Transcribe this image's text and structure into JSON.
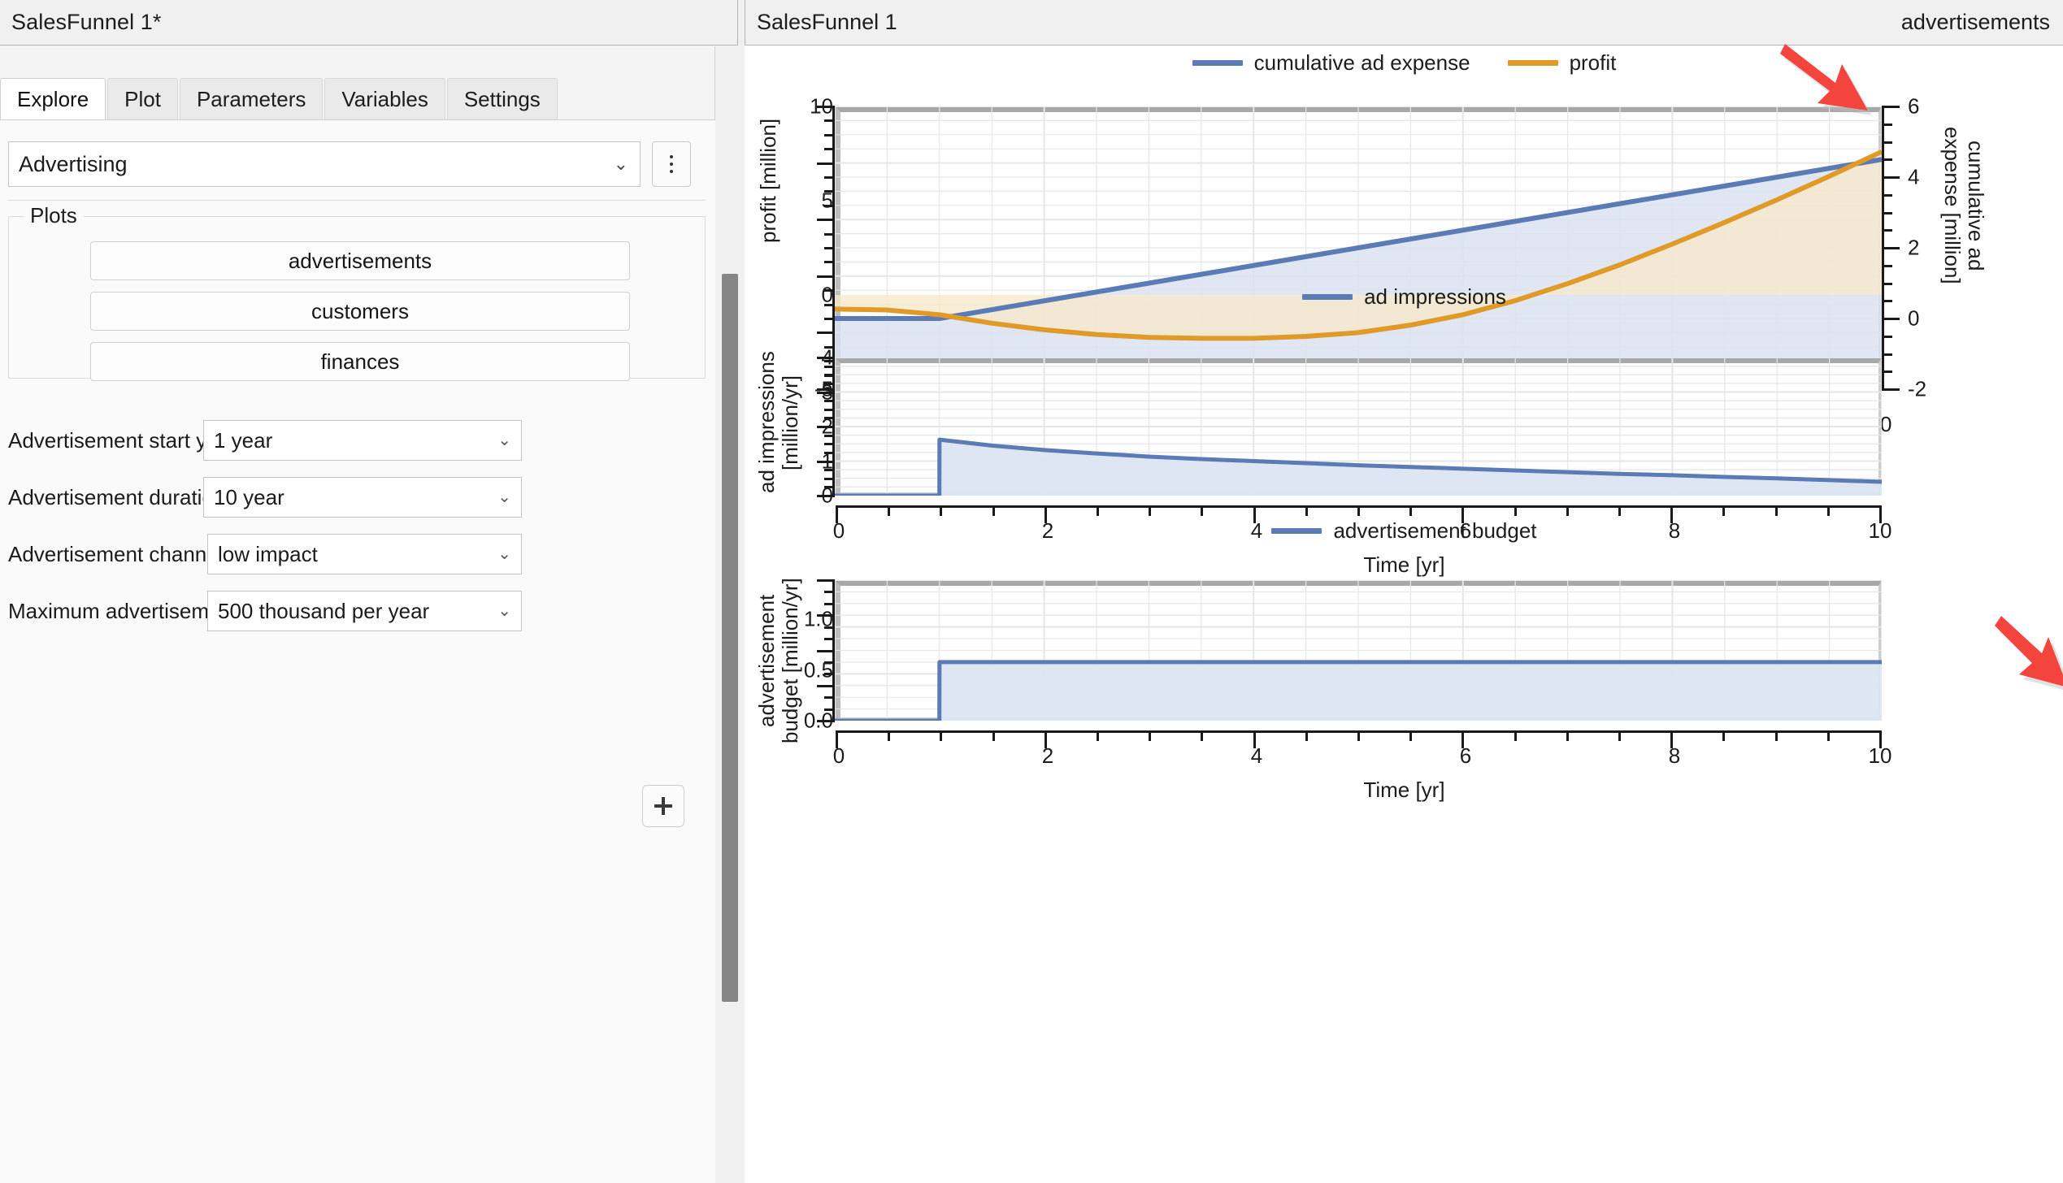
{
  "left_panel": {
    "title": "SalesFunnel 1*",
    "tabs": [
      {
        "label": "Explore",
        "active": true
      },
      {
        "label": "Plot",
        "active": false
      },
      {
        "label": "Parameters",
        "active": false
      },
      {
        "label": "Variables",
        "active": false
      },
      {
        "label": "Settings",
        "active": false
      }
    ],
    "model_select": {
      "value": "Advertising",
      "chevron": "chevron-down-icon"
    },
    "kebab": "more-options-icon",
    "plots_group": {
      "legend": "Plots",
      "buttons": [
        "advertisements",
        "customers",
        "finances"
      ]
    },
    "parameters": [
      {
        "label": "Advertisement start year:",
        "value": "1 year"
      },
      {
        "label": "Advertisement duration:",
        "value": "10 year"
      },
      {
        "label": "Advertisement channel impact:",
        "value": "low impact"
      },
      {
        "label": "Maximum advertisement funds:",
        "value": "500 thousand per year"
      }
    ],
    "add_button": "add-icon"
  },
  "right_panel": {
    "title": "SalesFunnel 1",
    "tab_label": "advertisements"
  },
  "colors": {
    "blue": "#5a7bb5",
    "orange": "#e09a28",
    "blue_fill": "#dde4f0",
    "orange_fill": "#f5e6c8",
    "arrow_red": "#f4443e",
    "frame": "#a8a8a8",
    "grid": "#e8e8e8"
  },
  "chart_data": [
    {
      "type": "line",
      "title": "",
      "xlabel": "Time [yr]",
      "ylabel": "profit [million]",
      "ylabel_right": "cumulative ad\nexpense [million]",
      "xlim": [
        0,
        10
      ],
      "ylim": [
        -5,
        10
      ],
      "ylim_right": [
        -2,
        6
      ],
      "xticks": [
        0,
        2,
        4,
        6,
        8,
        10
      ],
      "yticks": [
        -5,
        0,
        5,
        10
      ],
      "yticks_right": [
        -2,
        0,
        2,
        4,
        6
      ],
      "grid": true,
      "legend_position": "top-center",
      "series": [
        {
          "name": "cumulative ad expense",
          "color": "#5a7bb5",
          "axis": "right",
          "x": [
            0,
            0.5,
            1.0,
            1.5,
            2.0,
            2.5,
            3.0,
            3.5,
            4.0,
            4.5,
            5.0,
            5.5,
            6.0,
            6.5,
            7.0,
            7.5,
            8.0,
            8.5,
            9.0,
            9.5,
            10.0
          ],
          "y": [
            0.0,
            0.0,
            0.0,
            0.25,
            0.5,
            0.75,
            1.0,
            1.25,
            1.5,
            1.75,
            2.0,
            2.25,
            2.5,
            2.75,
            3.0,
            3.25,
            3.5,
            3.75,
            4.0,
            4.25,
            4.5
          ]
        },
        {
          "name": "profit",
          "color": "#e09a28",
          "axis": "left",
          "x": [
            0,
            0.5,
            1.0,
            1.5,
            2.0,
            2.5,
            3.0,
            3.5,
            4.0,
            4.5,
            5.0,
            5.5,
            6.0,
            6.5,
            7.0,
            7.5,
            8.0,
            8.5,
            9.0,
            9.5,
            10.0
          ],
          "y": [
            -0.75,
            -0.8,
            -1.05,
            -1.5,
            -1.85,
            -2.1,
            -2.25,
            -2.3,
            -2.3,
            -2.2,
            -2.0,
            -1.6,
            -1.05,
            -0.3,
            0.6,
            1.6,
            2.7,
            3.85,
            5.05,
            6.3,
            7.6
          ]
        }
      ]
    },
    {
      "type": "line",
      "title": "",
      "xlabel": "Time [yr]",
      "ylabel": "ad impressions\n[million/yr]",
      "xlim": [
        0,
        10
      ],
      "ylim": [
        0,
        4
      ],
      "xticks": [
        0,
        2,
        4,
        6,
        8,
        10
      ],
      "yticks": [
        0,
        1,
        2,
        3,
        4
      ],
      "grid": true,
      "legend_position": "top-center",
      "series": [
        {
          "name": "ad impressions",
          "color": "#5a7bb5",
          "x": [
            0,
            0.5,
            0.999,
            1.0,
            1.5,
            2.0,
            2.5,
            3.0,
            3.5,
            4.0,
            4.5,
            5.0,
            5.5,
            6.0,
            6.5,
            7.0,
            7.5,
            8.0,
            8.5,
            9.0,
            9.5,
            10.0
          ],
          "y": [
            0.0,
            0.0,
            0.0,
            1.62,
            1.45,
            1.32,
            1.22,
            1.13,
            1.06,
            1.0,
            0.94,
            0.88,
            0.83,
            0.78,
            0.73,
            0.68,
            0.63,
            0.59,
            0.54,
            0.5,
            0.45,
            0.4
          ]
        }
      ]
    },
    {
      "type": "line",
      "title": "",
      "xlabel": "Time [yr]",
      "ylabel": "advertisement\nbudget [million/yr]",
      "xlim": [
        0,
        10
      ],
      "ylim": [
        0.0,
        1.2
      ],
      "xticks": [
        0,
        2,
        4,
        6,
        8,
        10
      ],
      "yticks": [
        0.0,
        0.5,
        1.0
      ],
      "ytick_labels": [
        "0.0",
        "0.5",
        "1.0"
      ],
      "grid": true,
      "legend_position": "top-center",
      "series": [
        {
          "name": "advertisement budget",
          "color": "#5a7bb5",
          "x": [
            0,
            0.5,
            0.999,
            1.0,
            2.0,
            4.0,
            6.0,
            8.0,
            10.0
          ],
          "y": [
            0.0,
            0.0,
            0.0,
            0.5,
            0.5,
            0.5,
            0.5,
            0.5,
            0.5
          ]
        }
      ]
    }
  ],
  "annotations": [
    {
      "name": "arrow-chart1",
      "shape": "arrow-down-right",
      "color": "#f4443e"
    },
    {
      "name": "arrow-chart2",
      "shape": "arrow-down-right",
      "color": "#f4443e"
    }
  ]
}
